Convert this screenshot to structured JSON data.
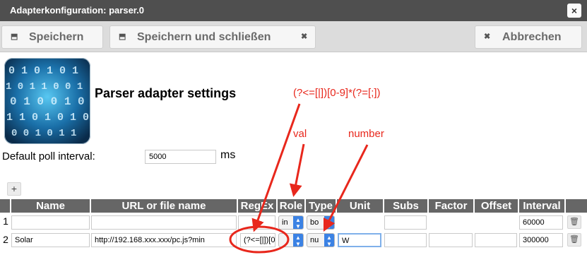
{
  "window": {
    "title": "Adapterkonfiguration: parser.0",
    "close_icon": "×"
  },
  "toolbar": {
    "save_label": "Speichern",
    "save_close_label": "Speichern und schließen",
    "cancel_label": "Abbrechen",
    "save_icon": "⬒",
    "close_icon": "✖",
    "cancel_icon": "✖"
  },
  "settings": {
    "heading": "Parser adapter settings",
    "poll_label": "Default poll interval:",
    "poll_value": "5000",
    "poll_unit": "ms"
  },
  "table": {
    "add_icon": "+",
    "columns": [
      "Name",
      "URL or file name",
      "RegEx",
      "Role",
      "Type",
      "Unit",
      "Subs",
      "Factor",
      "Offset",
      "Interval"
    ],
    "rows": [
      {
        "num": "1",
        "name": "",
        "url": "",
        "regex": "",
        "role": "in",
        "type": "bo",
        "unit": "",
        "subs": "",
        "factor": "",
        "offset": "",
        "interval": "60000"
      },
      {
        "num": "2",
        "name": "Solar",
        "url": "http://192.168.xxx.xxx/pc.js?min",
        "regex": "(?<=[|])[0",
        "role": "",
        "type": "nu",
        "unit": "W",
        "subs": "",
        "factor": "",
        "offset": "",
        "interval": "300000"
      }
    ]
  },
  "annotations": {
    "regex_text": "(?<=[|])[0-9]*(?=[;])",
    "role_text": "val",
    "type_text": "number",
    "color": "#e8271c"
  },
  "colors": {
    "titlebar": "#4f4f4f",
    "header": "#666666",
    "select_accent": "#3b82e4"
  }
}
